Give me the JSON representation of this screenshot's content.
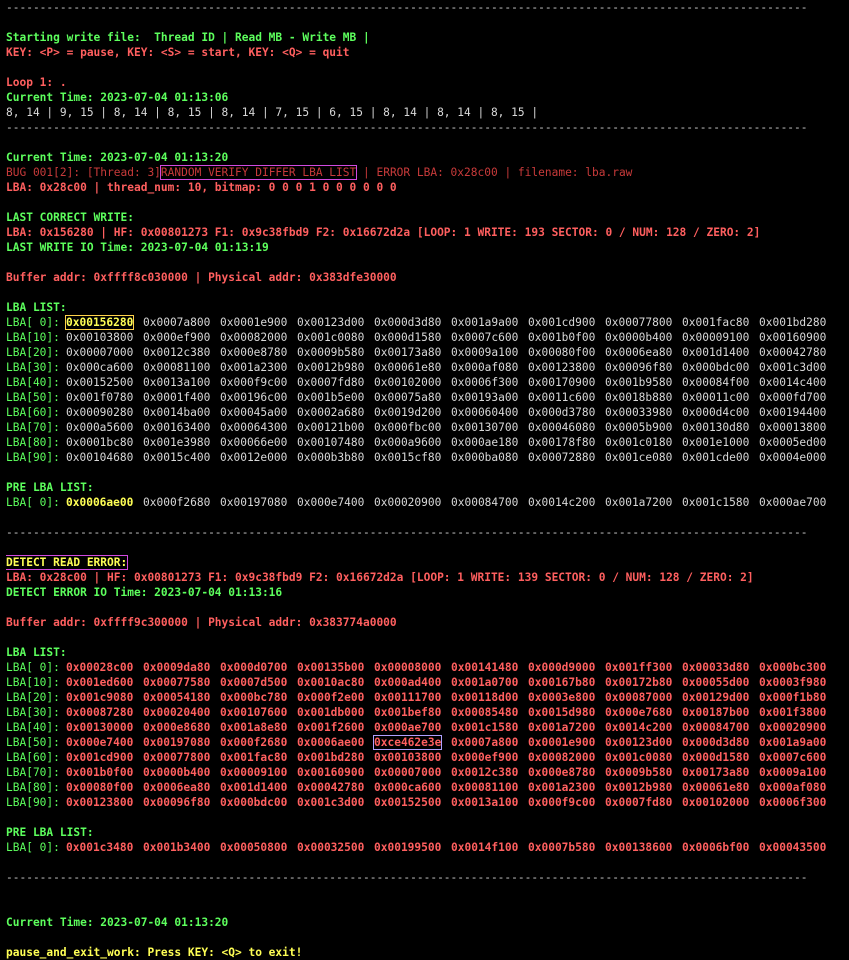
{
  "rule": "-----------------------------------------------------------------------------------------------------------------------",
  "header": {
    "start_line": "Starting write file:  Thread ID | Read MB - Write MB |",
    "key_line": "KEY: <P> = pause, KEY: <S> = start, KEY: <Q> = quit"
  },
  "loop": {
    "label": "Loop 1: .",
    "time": "Current Time: 2023-07-04 01:13:06",
    "stats": "8, 14 | 9, 15 | 8, 14 | 8, 15 | 8, 14 | 7, 15 | 6, 15 | 8, 14 | 8, 14 | 8, 15 |"
  },
  "bug": {
    "time": "Current Time: 2023-07-04 01:13:20",
    "prefix": "BUG 001[2]: [Thread: 3]",
    "tag": "RANDOM VERIFY DIFFER LBA LIST",
    "suffix": "| ERROR LBA: 0x28c00 | filename: lba.raw",
    "detail": "LBA: 0x28c00 | thread_num: 10, bitmap: 0 0 0 1 0 0 0 0 0 0"
  },
  "last_write": {
    "title": "LAST CORRECT WRITE:",
    "info": "LBA: 0x156280 | HF: 0x00801273 F1: 0x9c38fbd9 F2: 0x16672d2a [LOOP: 1 WRITE: 193 SECTOR: 0 / NUM: 128 / ZERO: 2]",
    "io_time": "LAST WRITE IO Time: 2023-07-04 01:13:19",
    "buffer": "Buffer addr: 0xffff8c030000 | Physical addr: 0x383dfe30000",
    "lba_title": "LBA LIST:",
    "rows": [
      {
        "label": "LBA[ 0]:",
        "cells": [
          "0x00156280",
          "0x0007a800",
          "0x0001e900",
          "0x00123d00",
          "0x000d3d80",
          "0x001a9a00",
          "0x001cd900",
          "0x00077800",
          "0x001fac80",
          "0x001bd280"
        ]
      },
      {
        "label": "LBA[10]:",
        "cells": [
          "0x00103800",
          "0x000ef900",
          "0x00082000",
          "0x001c0080",
          "0x000d1580",
          "0x0007c600",
          "0x001b0f00",
          "0x0000b400",
          "0x00009100",
          "0x00160900"
        ]
      },
      {
        "label": "LBA[20]:",
        "cells": [
          "0x00007000",
          "0x0012c380",
          "0x000e8780",
          "0x0009b580",
          "0x00173a80",
          "0x0009a100",
          "0x00080f00",
          "0x0006ea80",
          "0x001d1400",
          "0x00042780"
        ]
      },
      {
        "label": "LBA[30]:",
        "cells": [
          "0x000ca600",
          "0x00081100",
          "0x001a2300",
          "0x0012b980",
          "0x00061e80",
          "0x000af080",
          "0x00123800",
          "0x00096f80",
          "0x000bdc00",
          "0x001c3d00"
        ]
      },
      {
        "label": "LBA[40]:",
        "cells": [
          "0x00152500",
          "0x0013a100",
          "0x000f9c00",
          "0x0007fd80",
          "0x00102000",
          "0x0006f300",
          "0x00170900",
          "0x001b9580",
          "0x00084f00",
          "0x0014c400"
        ]
      },
      {
        "label": "LBA[50]:",
        "cells": [
          "0x001f0780",
          "0x0001f400",
          "0x00196c00",
          "0x001b5e00",
          "0x00075a80",
          "0x00193a00",
          "0x0011c600",
          "0x0018b880",
          "0x00011c00",
          "0x000fd700"
        ]
      },
      {
        "label": "LBA[60]:",
        "cells": [
          "0x00090280",
          "0x0014ba00",
          "0x00045a00",
          "0x0002a680",
          "0x0019d200",
          "0x00060400",
          "0x000d3780",
          "0x00033980",
          "0x000d4c00",
          "0x00194400"
        ]
      },
      {
        "label": "LBA[70]:",
        "cells": [
          "0x000a5600",
          "0x00163400",
          "0x00064300",
          "0x00121b00",
          "0x000fbc00",
          "0x00130700",
          "0x00046080",
          "0x0005b900",
          "0x00130d80",
          "0x00013800"
        ]
      },
      {
        "label": "LBA[80]:",
        "cells": [
          "0x0001bc80",
          "0x001e3980",
          "0x00066e00",
          "0x00107480",
          "0x000a9600",
          "0x000ae180",
          "0x00178f80",
          "0x001c0180",
          "0x001e1000",
          "0x0005ed00"
        ]
      },
      {
        "label": "LBA[90]:",
        "cells": [
          "0x00104680",
          "0x0015c400",
          "0x0012e000",
          "0x000b3b80",
          "0x0015cf80",
          "0x000ba080",
          "0x00072880",
          "0x001ce080",
          "0x001cde00",
          "0x0004e000"
        ]
      }
    ],
    "pre_title": "PRE LBA LIST:",
    "pre_row": {
      "label": "LBA[ 0]:",
      "cells": [
        "0x0006ae00",
        "0x000f2680",
        "0x00197080",
        "0x000e7400",
        "0x00020900",
        "0x00084700",
        "0x0014c200",
        "0x001a7200",
        "0x001c1580",
        "0x000ae700"
      ]
    }
  },
  "detect": {
    "title": "DETECT READ ERROR:",
    "info": "LBA: 0x28c00 | HF: 0x00801273 F1: 0x9c38fbd9 F2: 0x16672d2a [LOOP: 1 WRITE: 139 SECTOR: 0 / NUM: 128 / ZERO: 2]",
    "io_time": "DETECT ERROR IO Time: 2023-07-04 01:13:16",
    "buffer": "Buffer addr: 0xffff9c300000 | Physical addr: 0x383774a0000",
    "lba_title": "LBA LIST:",
    "rows": [
      {
        "label": "LBA[ 0]:",
        "cells": [
          "0x00028c00",
          "0x0009da80",
          "0x000d0700",
          "0x00135b00",
          "0x00008000",
          "0x00141480",
          "0x000d9000",
          "0x001ff300",
          "0x00033d80",
          "0x000bc300"
        ]
      },
      {
        "label": "LBA[10]:",
        "cells": [
          "0x001ed600",
          "0x00077580",
          "0x0007d500",
          "0x0010ac80",
          "0x000ad400",
          "0x001a0700",
          "0x00167b80",
          "0x00172b80",
          "0x00055d00",
          "0x0003f980"
        ]
      },
      {
        "label": "LBA[20]:",
        "cells": [
          "0x001c9080",
          "0x00054180",
          "0x000bc780",
          "0x000f2e00",
          "0x00111700",
          "0x00118d00",
          "0x0003e800",
          "0x00087000",
          "0x00129d00",
          "0x000f1b80"
        ]
      },
      {
        "label": "LBA[30]:",
        "cells": [
          "0x00087280",
          "0x00020400",
          "0x00107600",
          "0x001db000",
          "0x001bef80",
          "0x00085480",
          "0x0015d980",
          "0x000e7680",
          "0x00187b00",
          "0x001f3800"
        ]
      },
      {
        "label": "LBA[40]:",
        "cells": [
          "0x00130000",
          "0x000e8680",
          "0x001a8e80",
          "0x001f2600",
          "0x000ae700",
          "0x001c1580",
          "0x001a7200",
          "0x0014c200",
          "0x00084700",
          "0x00020900"
        ]
      },
      {
        "label": "LBA[50]:",
        "cells": [
          "0x000e7400",
          "0x00197080",
          "0x000f2680",
          "0x0006ae00",
          "0xce462e3e",
          "0x0007a800",
          "0x0001e900",
          "0x00123d00",
          "0x000d3d80",
          "0x001a9a00"
        ]
      },
      {
        "label": "LBA[60]:",
        "cells": [
          "0x001cd900",
          "0x00077800",
          "0x001fac80",
          "0x001bd280",
          "0x00103800",
          "0x000ef900",
          "0x00082000",
          "0x001c0080",
          "0x000d1580",
          "0x0007c600"
        ]
      },
      {
        "label": "LBA[70]:",
        "cells": [
          "0x001b0f00",
          "0x0000b400",
          "0x00009100",
          "0x00160900",
          "0x00007000",
          "0x0012c380",
          "0x000e8780",
          "0x0009b580",
          "0x00173a80",
          "0x0009a100"
        ]
      },
      {
        "label": "LBA[80]:",
        "cells": [
          "0x00080f00",
          "0x0006ea80",
          "0x001d1400",
          "0x00042780",
          "0x000ca600",
          "0x00081100",
          "0x001a2300",
          "0x0012b980",
          "0x00061e80",
          "0x000af080"
        ]
      },
      {
        "label": "LBA[90]:",
        "cells": [
          "0x00123800",
          "0x00096f80",
          "0x000bdc00",
          "0x001c3d00",
          "0x00152500",
          "0x0013a100",
          "0x000f9c00",
          "0x0007fd80",
          "0x00102000",
          "0x0006f300"
        ]
      }
    ],
    "pre_title": "PRE LBA LIST:",
    "pre_row": {
      "label": "LBA[ 0]:",
      "cells": [
        "0x001c3480",
        "0x001b3400",
        "0x00050800",
        "0x00032500",
        "0x00199500",
        "0x0014f100",
        "0x0007b580",
        "0x00138600",
        "0x0006bf00",
        "0x00043500"
      ]
    }
  },
  "footer": {
    "time": "Current Time: 2023-07-04 01:13:20",
    "exit": "pause_and_exit_work: Press KEY: <Q> to exit!"
  },
  "colors": {
    "background": "#000000",
    "green": "#5dff5d",
    "red": "#ff5f5f",
    "yellow": "#ffff55",
    "highlight_box": "#d24adf"
  }
}
